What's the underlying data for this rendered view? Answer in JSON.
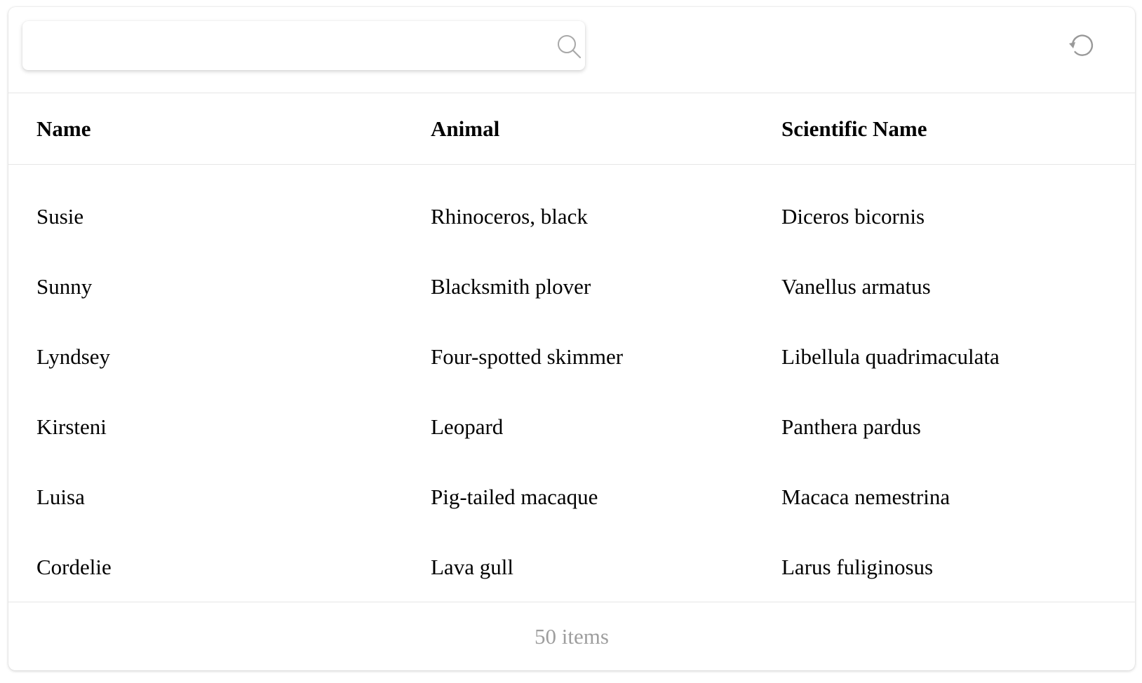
{
  "search": {
    "value": "",
    "placeholder": ""
  },
  "icons": {
    "search": "search-icon",
    "refresh": "refresh-icon"
  },
  "table": {
    "columns": [
      "Name",
      "Animal",
      "Scientific Name"
    ],
    "rows": [
      [
        "Susie",
        "Rhinoceros, black",
        "Diceros bicornis"
      ],
      [
        "Sunny",
        "Blacksmith plover",
        "Vanellus armatus"
      ],
      [
        "Lyndsey",
        "Four-spotted skimmer",
        "Libellula quadrimaculata"
      ],
      [
        "Kirsteni",
        "Leopard",
        "Panthera pardus"
      ],
      [
        "Luisa",
        "Pig-tailed macaque",
        "Macaca nemestrina"
      ],
      [
        "Cordelie",
        "Lava gull",
        "Larus fuliginosus"
      ]
    ]
  },
  "footer": {
    "count_label": "50 items"
  },
  "colors": {
    "border": "#e6e6e6",
    "muted_text": "#9e9e9e",
    "icon": "#999999"
  }
}
